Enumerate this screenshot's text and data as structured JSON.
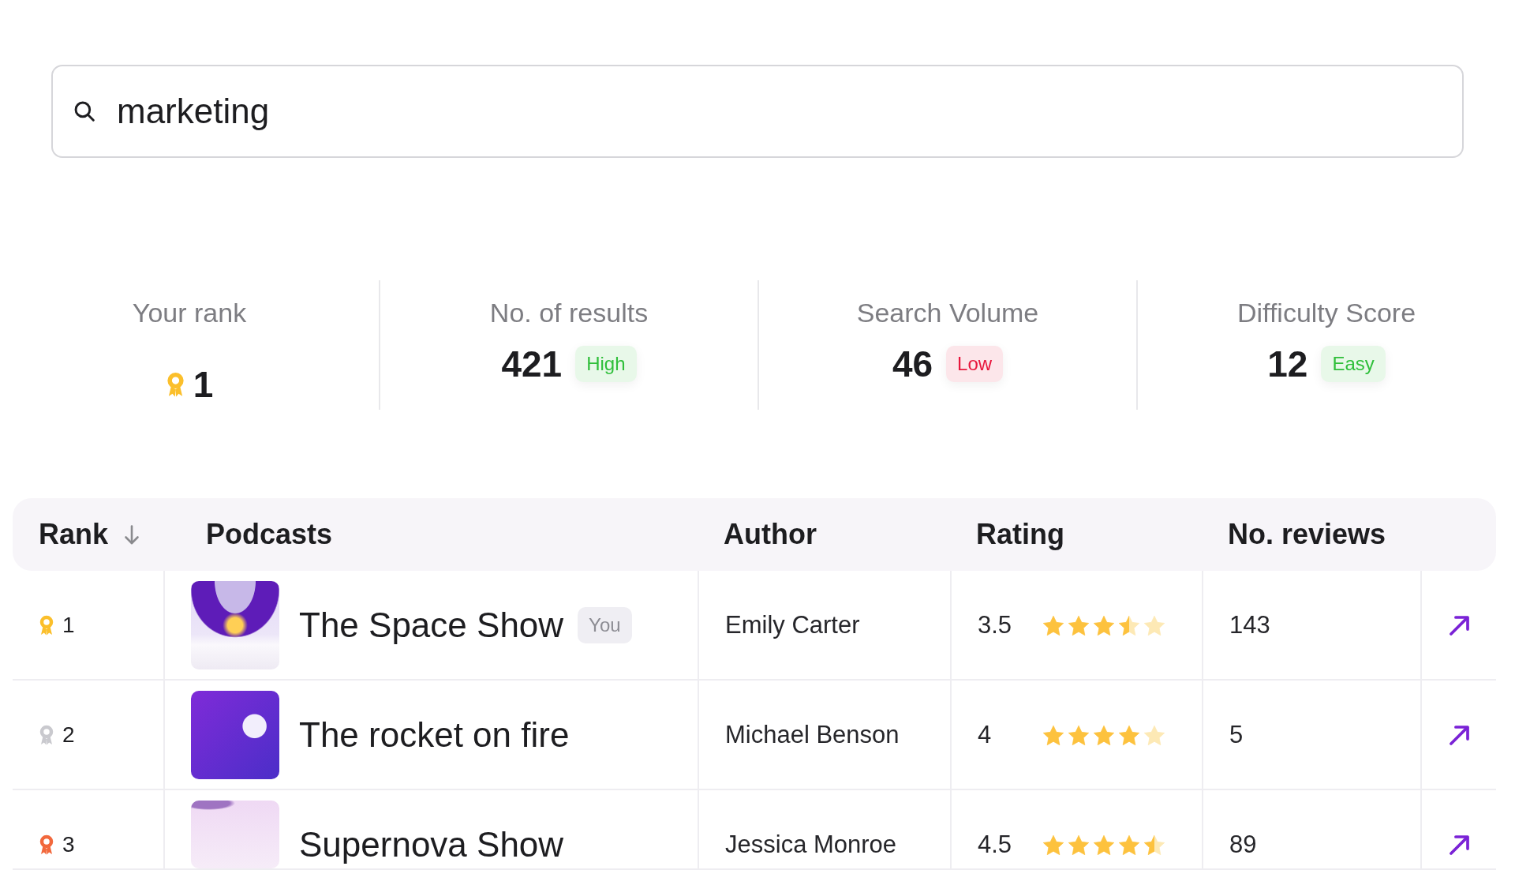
{
  "search": {
    "value": "marketing"
  },
  "stats": [
    {
      "kind": "rank",
      "label": "Your rank",
      "value": "1",
      "color": "#fbbf2b"
    },
    {
      "kind": "metric",
      "label": "No. of results",
      "value": "421",
      "badge": {
        "text": "High",
        "color": "#2fbf3a"
      }
    },
    {
      "kind": "metric",
      "label": "Search Volume",
      "value": "46",
      "badge": {
        "text": "Low",
        "color": "#e8173d"
      }
    },
    {
      "kind": "metric",
      "label": "Difficulty Score",
      "value": "12",
      "badge": {
        "text": "Easy",
        "color": "#2fbf3a"
      }
    }
  ],
  "table": {
    "columns": [
      {
        "label": "Rank",
        "sorted": true
      },
      {
        "label": "Podcasts",
        "sorted": false
      },
      {
        "label": "Author",
        "sorted": false
      },
      {
        "label": "Rating",
        "sorted": false
      },
      {
        "label": "No. reviews",
        "sorted": false
      }
    ],
    "rows": [
      {
        "rank": "1",
        "color": "#fbbf2b",
        "podcast": "The Space Show",
        "tag": "You",
        "author": "Emily Carter",
        "rating": "3.5",
        "stars": 3.5,
        "reviews": "143"
      },
      {
        "rank": "2",
        "color": "#c9c9ce",
        "podcast": "The rocket on fire",
        "author": "Michael Benson",
        "rating": "4",
        "stars": 4,
        "reviews": "5"
      },
      {
        "rank": "3",
        "color": "#f2683c",
        "podcast": "Supernova Show",
        "author": "Jessica Monroe",
        "rating": "4.5",
        "stars": 4.5,
        "reviews": "89"
      }
    ]
  }
}
